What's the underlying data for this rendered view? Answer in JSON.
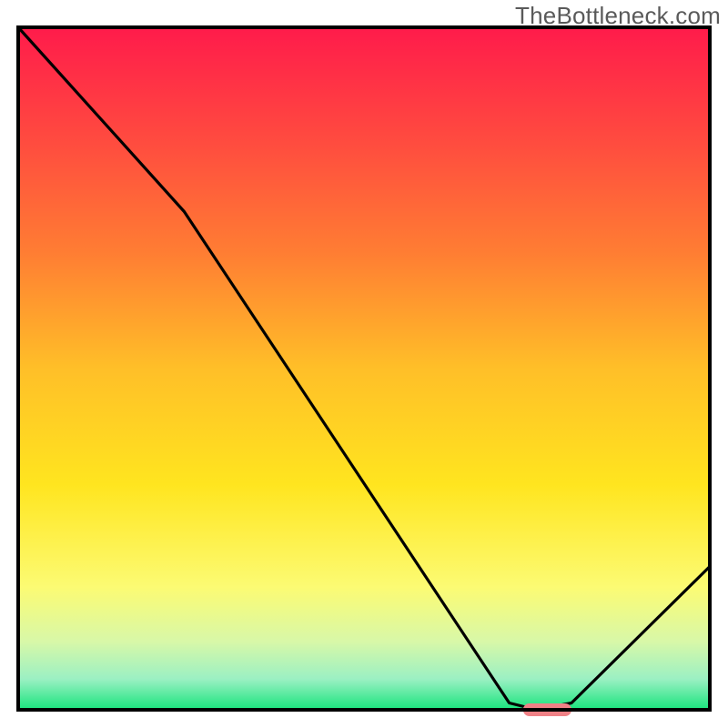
{
  "watermark": "TheBottleneck.com",
  "chart_data": {
    "type": "line",
    "title": "",
    "xlabel": "",
    "ylabel": "",
    "xlim": [
      0,
      100
    ],
    "ylim": [
      0,
      100
    ],
    "x": [
      0,
      24,
      71,
      75,
      80,
      100
    ],
    "values": [
      100,
      73,
      1,
      0,
      1,
      21
    ],
    "marker": {
      "x_start": 73,
      "x_end": 80,
      "y": 0,
      "color": "#ef8186"
    },
    "background_gradient": {
      "stops": [
        {
          "offset": 0.0,
          "color": "#ff1b4b"
        },
        {
          "offset": 0.17,
          "color": "#ff4c3f"
        },
        {
          "offset": 0.33,
          "color": "#ff7d33"
        },
        {
          "offset": 0.5,
          "color": "#ffbf28"
        },
        {
          "offset": 0.67,
          "color": "#ffe51f"
        },
        {
          "offset": 0.82,
          "color": "#fcfb73"
        },
        {
          "offset": 0.9,
          "color": "#d8f8a8"
        },
        {
          "offset": 0.955,
          "color": "#9bf0c3"
        },
        {
          "offset": 1.0,
          "color": "#18e47c"
        }
      ]
    },
    "border_color": "#000000",
    "line_color": "#000000",
    "line_width": 3.2
  }
}
